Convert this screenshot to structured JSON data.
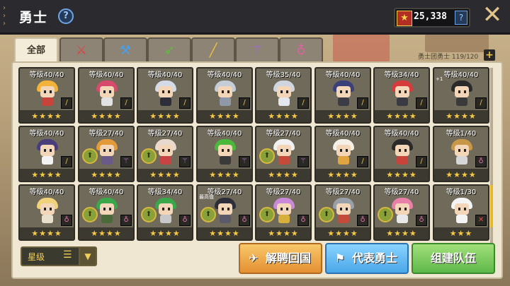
{
  "header": {
    "title": "勇士",
    "currency_amount": "25,338"
  },
  "tabs": [
    {
      "label": "全部",
      "icon": "all",
      "active": true
    },
    {
      "label": "",
      "icon": "sword-icon",
      "color": "#e04040"
    },
    {
      "label": "",
      "icon": "hammer-icon",
      "color": "#4aa0e8"
    },
    {
      "label": "",
      "icon": "bow-icon",
      "color": "#5cc03a"
    },
    {
      "label": "",
      "icon": "rifle-icon",
      "color": "#e8c040"
    },
    {
      "label": "",
      "icon": "staff-icon",
      "color": "#a06ad8"
    },
    {
      "label": "",
      "icon": "amulet-icon",
      "color": "#e060a0"
    }
  ],
  "roster_count": "勇士团勇士 119/120",
  "heroes": [
    {
      "level": "等级40/40",
      "stars": "★★★★",
      "weapon": "gold",
      "hair": "#f3b23a",
      "body": "#c8443a"
    },
    {
      "level": "等级40/40",
      "stars": "★★★★",
      "weapon": "gold",
      "hair": "#d64a6e",
      "body": "#e2e2e2"
    },
    {
      "level": "等级40/40",
      "stars": "★★★★",
      "weapon": "gold",
      "hair": "#d5dbe6",
      "body": "#2e2e3a"
    },
    {
      "level": "等级40/40",
      "stars": "★★★★",
      "weapon": "gold",
      "hair": "#c4ccd6",
      "body": "#8f98a8"
    },
    {
      "level": "等级35/40",
      "stars": "★★★★",
      "weapon": "gold",
      "hair": "#cfd6e0",
      "body": "#e4e8ee"
    },
    {
      "level": "等级40/40",
      "stars": "★★★★",
      "weapon": "gold",
      "hair": "#3b3f7a",
      "body": "#3c3c46"
    },
    {
      "level": "等级34/40",
      "stars": "★★★★",
      "weapon": "gold",
      "hair": "#d63a3a",
      "body": "#3a3a42"
    },
    {
      "level": "等级40/40",
      "stars": "★★★★",
      "weapon": "gold",
      "hair": "#2a2a2a",
      "body": "#3a3a3a",
      "sub": "+1"
    },
    {
      "level": "等级40/40",
      "stars": "★★★★",
      "weapon": "gold",
      "hair": "#4a3d7c",
      "body": "#f2f2f2"
    },
    {
      "level": "等级27/40",
      "stars": "★★★★",
      "weapon": "purple",
      "medal": true,
      "hair": "#e29a3a",
      "body": "#6a5a8a"
    },
    {
      "level": "等级27/40",
      "stars": "★★★★",
      "weapon": "purple",
      "medal": true,
      "hair": "#e8d9cf",
      "body": "#c84444"
    },
    {
      "level": "等级40/40",
      "stars": "★★★★",
      "weapon": "purple",
      "hair": "#4ab83a",
      "body": "#3a3a3a"
    },
    {
      "level": "等级27/40",
      "stars": "★★★★",
      "weapon": "purple",
      "medal": true,
      "hair": "#f0f0f0",
      "body": "#c44a3a"
    },
    {
      "level": "等级40/40",
      "stars": "★★★★",
      "weapon": "gold",
      "hair": "#f4f0e8",
      "body": "#e0a440"
    },
    {
      "level": "等级40/40",
      "stars": "★★★★",
      "weapon": "gold",
      "hair": "#2a2a2a",
      "body": "#c8433a"
    },
    {
      "level": "等级1/40",
      "stars": "★★★★",
      "weapon": "pink",
      "hair": "#c89848",
      "body": "#d6d6d6"
    },
    {
      "level": "等级40/40",
      "stars": "★★★★",
      "weapon": "pink",
      "hair": "#f0d27a",
      "body": "#e8e0cc"
    },
    {
      "level": "等级40/40",
      "stars": "★★★★",
      "weapon": "pink",
      "medal": true,
      "hair": "#3aa84a",
      "body": "#4a6a3a"
    },
    {
      "level": "等级34/40",
      "stars": "★★★★",
      "weapon": "pink",
      "medal": true,
      "hair": "#3aa84a",
      "body": "#c8c8c8"
    },
    {
      "level": "等级27/40",
      "stars": "★★★★",
      "weapon": "pink",
      "medal": true,
      "hair": "#2e2e3a",
      "body": "#5a5a6a",
      "sub": "最高值"
    },
    {
      "level": "等级27/40",
      "stars": "★★★★",
      "weapon": "pink",
      "medal": true,
      "hair": "#c88ad8",
      "body": "#d6b03a"
    },
    {
      "level": "等级27/40",
      "stars": "★★★★",
      "weapon": "pink",
      "medal": true,
      "hair": "#9aa0aa",
      "body": "#c44a3a"
    },
    {
      "level": "等级27/40",
      "stars": "★★★★",
      "weapon": "pink",
      "medal": true,
      "hair": "#e880a8",
      "body": "#e8e8e8"
    },
    {
      "level": "等级1/30",
      "stars": "★★★",
      "weapon": "red",
      "hair": "#f4f4f4",
      "body": "#f4f4f4"
    }
  ],
  "sort": {
    "label": "星级"
  },
  "buttons": {
    "hire": "解聘回国",
    "representative": "代表勇士",
    "form_team": "组建队伍"
  },
  "colors": {
    "topbar": "#2b2a2e",
    "star": "#f6c945",
    "hire_button": "#e49032",
    "rep_button": "#4aa7e8",
    "team_button": "#5eb84a"
  }
}
